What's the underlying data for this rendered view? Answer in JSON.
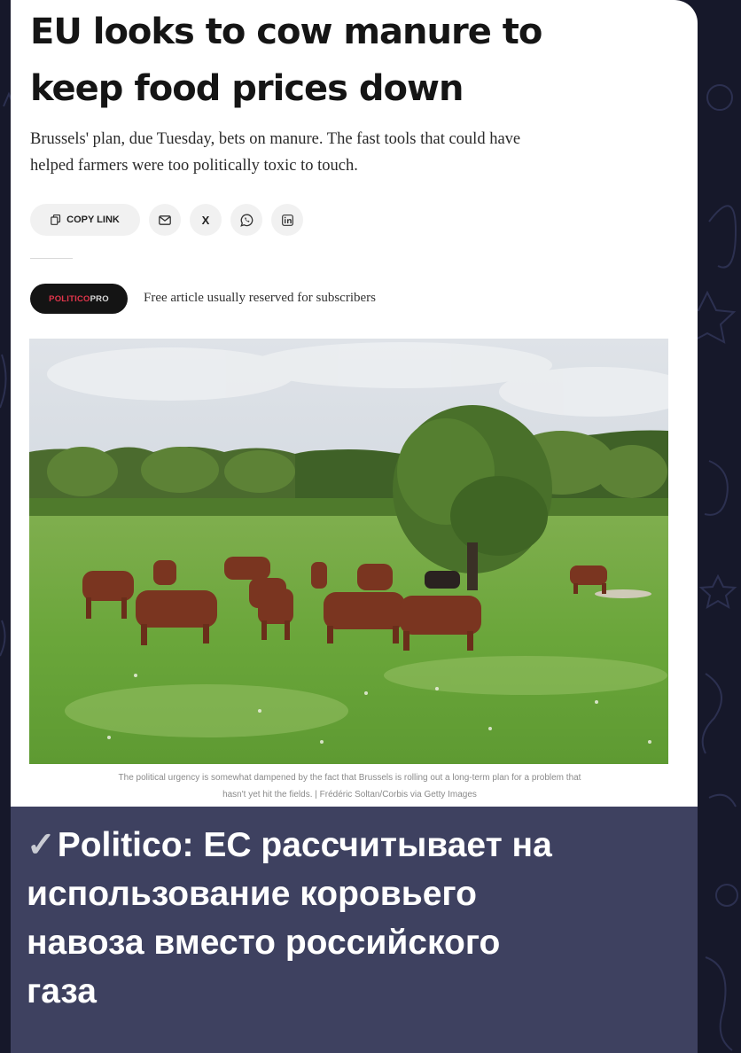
{
  "article": {
    "headline_line1": "EU looks to cow manure to",
    "headline_line2": "keep food prices down",
    "dek_line1": "Brussels' plan, due Tuesday, bets on manure. The fast tools that could have",
    "dek_line2": "helped farmers were too politically toxic to touch.",
    "share": {
      "copy_link_label": "COPY LINK",
      "buttons": [
        "mail-icon",
        "x-icon",
        "whatsapp-icon",
        "linkedin-icon"
      ],
      "x_label": "X"
    },
    "badge": {
      "part1": "POLITICO",
      "part2": "PRO"
    },
    "free_note": "Free article usually reserved for subscribers",
    "caption_line1": "The political urgency is somewhat dampened by the fact that Brussels is rolling out a long-term plan for a problem that",
    "caption_line2": "hasn't yet hit the fields. | Frédéric Soltan/Corbis via Getty Images"
  },
  "message": {
    "check_icon": "check-icon",
    "line1": "Politico: ЕС рассчитывает на",
    "line2": "использование коровьего",
    "line3": "навоза вместо российского",
    "line4": "газа"
  },
  "colors": {
    "background": "#16182a",
    "message_box": "#3e4160",
    "badge_accent": "#e2354b"
  }
}
